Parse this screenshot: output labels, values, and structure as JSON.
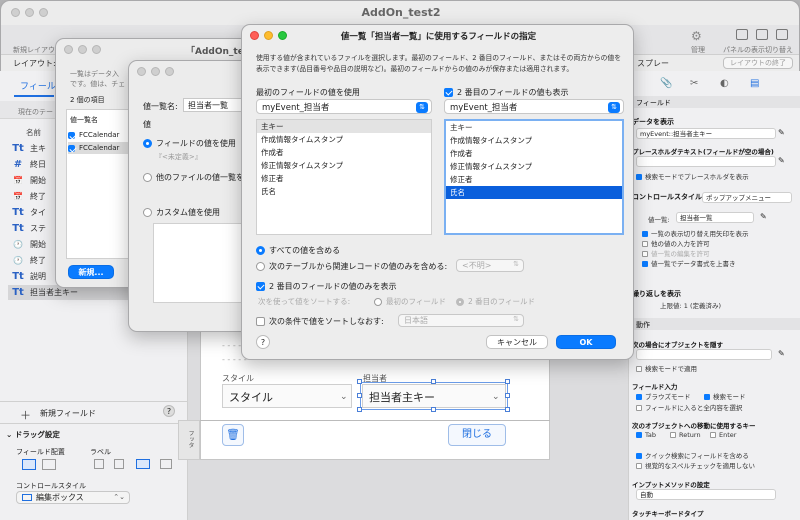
{
  "main_window": {
    "title": "AddOn_test2",
    "toolbar_left": "新規レイアウ",
    "layout_label": "レイアウト:",
    "right_toolbar": {
      "manage_label": "管理",
      "panel_label": "パネルの表示切り替え",
      "style_label": "スプレー",
      "exit_layout_button": "レイアウトの終了"
    }
  },
  "left_panel": {
    "tab_label": "フィールド",
    "current_table_label": "現在のテー",
    "name_header": "名前",
    "fields": [
      {
        "icon": "Tt",
        "label": "主キ"
      },
      {
        "icon": "#",
        "label": "終日"
      },
      {
        "icon": "📅",
        "label": "開始"
      },
      {
        "icon": "📅",
        "label": "終了"
      },
      {
        "icon": "Tt",
        "label": "タイ"
      },
      {
        "icon": "Tt",
        "label": "ステ"
      },
      {
        "icon": "🕐",
        "label": "開始"
      },
      {
        "icon": "🕐",
        "label": "終了"
      },
      {
        "icon": "Tt",
        "label": "説明"
      },
      {
        "icon": "Tt",
        "label": "担当者主キー"
      }
    ],
    "new_field_button": "新規フィールド",
    "help": "?",
    "drag_settings": "ドラッグ設定",
    "field_placement": "フィールド配置",
    "label_col": "ラベル",
    "control_style_label": "コントロールスタイル",
    "control_style_value": "編集ボックス"
  },
  "back_dialog1": {
    "title": "「AddOn_test",
    "desc1": "一覧はデータ入",
    "desc2": "です。値は、チェ",
    "count": "2 個の項目",
    "list_header": "値一覧名",
    "items": [
      "FCCalendar",
      "FCCalendar"
    ],
    "new_button": "新規..."
  },
  "back_dialog2": {
    "name_label": "値一覧名:",
    "name_value": "担当者一覧",
    "value_label": "値",
    "opt_field": "フィールドの値を使用",
    "undefined": "『<未定義>』",
    "opt_other_file": "他のファイルの値一覧を",
    "opt_custom": "カスタム値を使用"
  },
  "layout_canvas": {
    "style_label": "スタイル",
    "style_value": "スタイル",
    "person_label": "担当者",
    "person_value": "担当者主キー",
    "close_button": "閉じる",
    "footer_label": "フッタ",
    "trash": "🗑"
  },
  "main_dialog": {
    "title": "値一覧「担当者一覧」に使用するフィールドの指定",
    "description": "使用する値が含まれているファイルを選択します。最初のフィールド、2 番目のフィールド、またはその両方からの値を表示できます(品目番号や品目の説明など)。最初のフィールドからの値のみが保存または適用されます。",
    "first_field_label": "最初のフィールドの値を使用",
    "first_table": "myEvent_担当者",
    "first_fields": [
      "主キー",
      "作成情報タイムスタンプ",
      "作成者",
      "修正情報タイムスタンプ",
      "修正者",
      "氏名"
    ],
    "first_selected_index": 0,
    "second_check_label": "2 番目のフィールドの値も表示",
    "second_table": "myEvent_担当者",
    "second_fields": [
      "主キー",
      "作成情報タイムスタンプ",
      "作成者",
      "修正情報タイムスタンプ",
      "修正者",
      "氏名"
    ],
    "second_selected_index": 5,
    "include_all": "すべての値を含める",
    "include_related": "次のテーブルから関連レコードの値のみを含める:",
    "unknown": "<不明>",
    "show_second_only": "2 番目のフィールドの値のみを表示",
    "sort_by": "次を使って値をソートする:",
    "sort_first": "最初のフィールド",
    "sort_second": "2 番目のフィールド",
    "sort_condition": "次の条件で値をソートしなおす:",
    "language": "日本語",
    "help": "?",
    "cancel": "キャンセル",
    "ok": "OK"
  },
  "inspector": {
    "field_section": "フィールド",
    "data_display": "データを表示",
    "data_value": "myEvent::担当者主キー",
    "placeholder_label": "プレースホルダテキスト(フィールドが空の場合)",
    "placeholder_find": "検索モードでプレースホルダを表示",
    "control_style": "コントロールスタイル",
    "control_style_value": "ポップアップメニュー",
    "value_list_label": "値一覧:",
    "value_list_value": "担当者一覧",
    "opt1": "一覧の表示切り替え用矢印を表示",
    "opt2": "他の値の入力を許可",
    "opt3": "値一覧の編集を許可",
    "opt4": "値一覧でデータ書式を上書き",
    "repeat_label": "繰り返しを表示",
    "repeat_value": "上限値: 1 (定義済み)",
    "action_section": "動作",
    "enter_label": "次の場合にオブジェクトを隠す",
    "find_mode": "検索モードで適用",
    "field_entry": "フィールド入力",
    "browse_mode": "ブラウズモード",
    "search_mode": "検索モード",
    "select_all": "フィールドに入ると全内容を選択",
    "move_keys": "次のオブジェクトへの移動に使用するキー",
    "tab": "Tab",
    "return": "Return",
    "enter": "Enter",
    "quick_find": "クイック検索にフィールドを含める",
    "spellcheck": "視覚的なスペルチェックを適用しない",
    "input_method": "インプットメソッドの設定",
    "input_value": "自動",
    "touch_keyboard": "タッチキーボードタイプ"
  }
}
